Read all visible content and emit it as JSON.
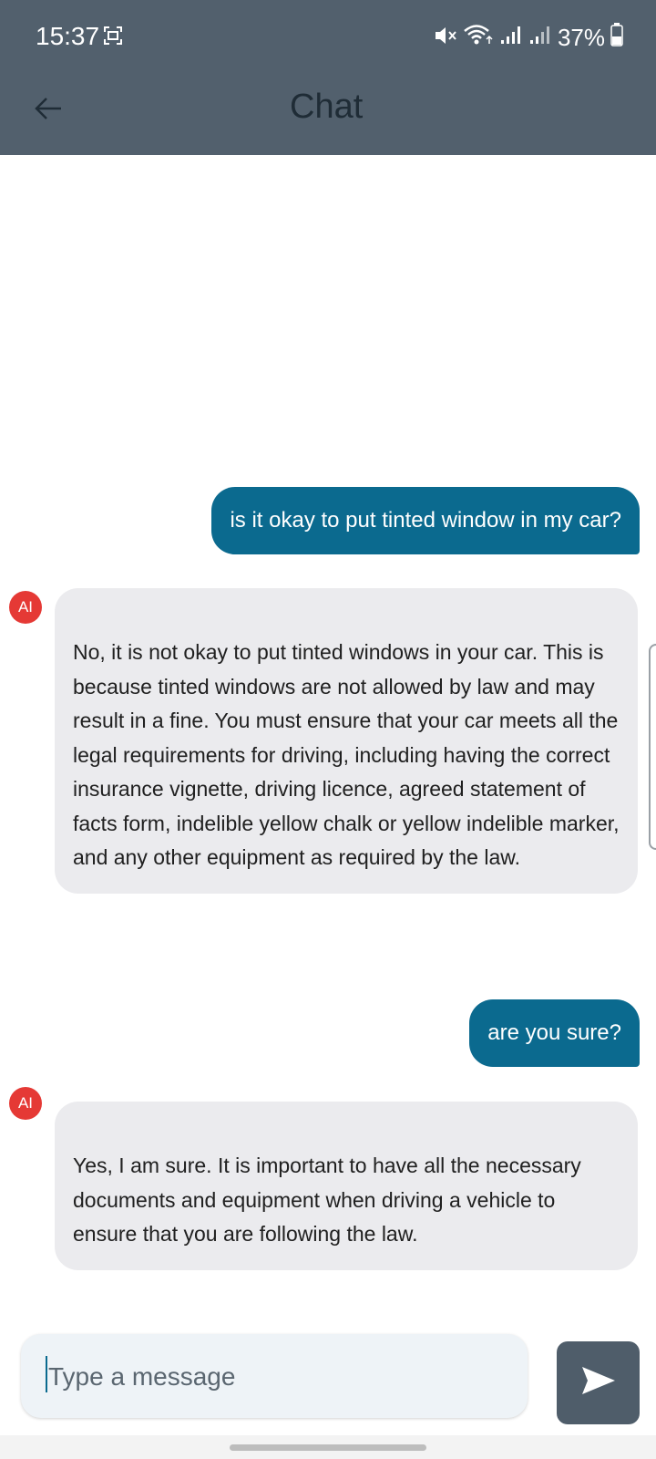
{
  "status_bar": {
    "time": "15:37",
    "battery": "37%",
    "icons": [
      "screenshot-icon",
      "mute-icon",
      "wifi-icon",
      "signal-icon",
      "signal-icon",
      "battery-icon"
    ]
  },
  "app_bar": {
    "title": "Chat",
    "back_icon": "arrow-left-icon"
  },
  "messages": [
    {
      "sender": "user",
      "text": "is it okay to put tinted window in my car?"
    },
    {
      "sender": "ai",
      "avatar": "AI",
      "text": "No, it is not okay to put tinted windows in your car. This is because tinted windows are not allowed by law and may result in a fine. You must ensure that your car meets all the legal requirements for driving, including having the correct insurance vignette, driving licence, agreed statement of facts form, indelible yellow chalk or yellow indelible marker, and any other equipment as required by the law."
    },
    {
      "sender": "user",
      "text": "are you sure?"
    },
    {
      "sender": "ai",
      "avatar": "AI",
      "text": "Yes, I am sure. It is important to have all the necessary documents and equipment when driving a vehicle to ensure that you are following the law."
    }
  ],
  "composer": {
    "placeholder": "Type a message",
    "send_icon": "send-icon"
  },
  "colors": {
    "header": "#52606d",
    "user_bubble": "#0b6a8f",
    "ai_bubble": "#ebebee",
    "avatar": "#e53935",
    "send_button": "#4f5d6a"
  }
}
